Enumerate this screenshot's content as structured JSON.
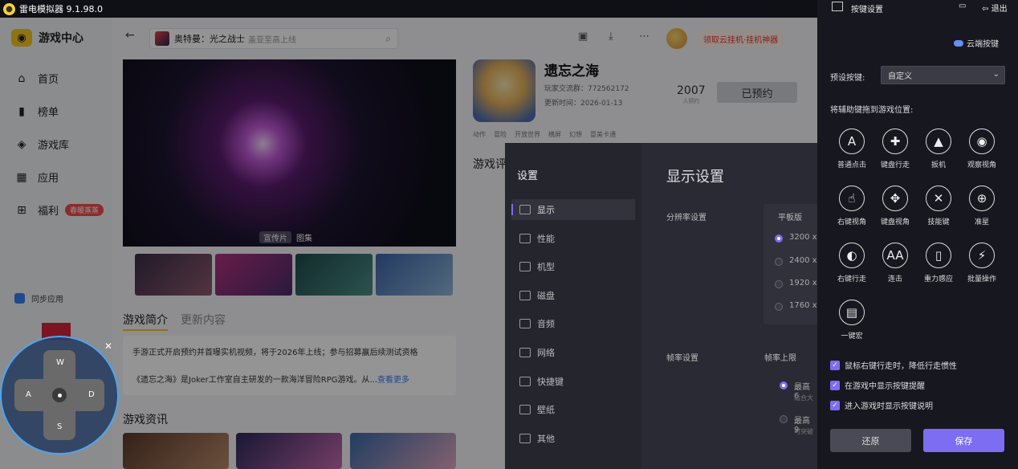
{
  "titlebar": {
    "title": "雷电模拟器 9.1.98.0"
  },
  "sidebar": {
    "brand": "游戏中心",
    "items": [
      {
        "label": "首页",
        "icon": "home-icon"
      },
      {
        "label": "榜单",
        "icon": "chart-icon"
      },
      {
        "label": "游戏库",
        "icon": "gamepad-icon"
      },
      {
        "label": "应用",
        "icon": "apps-icon"
      },
      {
        "label": "福利",
        "icon": "gift-icon",
        "badge": "春暖蒸蒸"
      }
    ],
    "sync": "同步应用"
  },
  "search": {
    "game": "奥特曼：光之战士",
    "placeholder": "盖亚至高上线"
  },
  "promo": "领取云挂机·挂机神器",
  "hero": {
    "tab_video": "宣传片",
    "tab_gallery": "图集"
  },
  "game": {
    "title": "遗忘之海",
    "group": "玩家交流群：772562172",
    "update": "更新时间：2026-01-13",
    "tags": [
      "动作",
      "冒险",
      "开放世界",
      "横屏",
      "幻想",
      "冒美卡通"
    ],
    "rating": "2007",
    "rating_sub": "人预约",
    "reserve_label": "已预约",
    "review_title": "游戏评"
  },
  "intro": {
    "tab_active": "游戏简介",
    "tab_other": "更新内容",
    "line1": "手游正式开启预约并首曝实机视频，将于2026年上线；参与招募赢后续测试资格",
    "line2": "《遗忘之海》是Joker工作室自主研发的一款海洋冒险RPG游戏。从...",
    "more": "查看更多"
  },
  "news_title": "游戏资讯",
  "settings": {
    "header": "设置",
    "items": [
      "显示",
      "性能",
      "机型",
      "磁盘",
      "音频",
      "网络",
      "快捷键",
      "壁纸",
      "其他"
    ],
    "active": 0,
    "title": "显示设置",
    "resolution_label": "分辨率设置",
    "tablet_label": "平板版",
    "resolutions": [
      "3200 x",
      "2400 x",
      "1920 x",
      "1760 x"
    ],
    "fps_label": "帧率设置",
    "fps_max_label": "帧率上限",
    "fps_opt1": "最高 6",
    "fps_opt1_sub": "适合大",
    "fps_opt2": "最高 9",
    "fps_opt2_sub": "可突破"
  },
  "keypanel": {
    "title": "按键设置",
    "exit": "退出",
    "cloud": "云端按键",
    "preset_label": "预设按键:",
    "preset_value": "自定义",
    "drag_hint": "将辅助键拖到游戏位置:",
    "keys": [
      {
        "label": "普通点击",
        "glyph": "A",
        "icon": "tap-a-icon"
      },
      {
        "label": "键盘行走",
        "glyph": "✚",
        "icon": "dpad-icon"
      },
      {
        "label": "扳机",
        "glyph": "▲",
        "icon": "bullet-icon"
      },
      {
        "label": "观察视角",
        "glyph": "◉",
        "icon": "eye-icon"
      },
      {
        "label": "右键视角",
        "glyph": "☝",
        "icon": "right-view-icon"
      },
      {
        "label": "键盘视角",
        "glyph": "✥",
        "icon": "keyboard-view-icon"
      },
      {
        "label": "技能键",
        "glyph": "✕",
        "icon": "skill-icon"
      },
      {
        "label": "准星",
        "glyph": "⊕",
        "icon": "crosshair-icon"
      },
      {
        "label": "右键行走",
        "glyph": "◐",
        "icon": "mouse-icon"
      },
      {
        "label": "连击",
        "glyph": "AA",
        "icon": "combo-icon"
      },
      {
        "label": "重力感应",
        "glyph": "▯",
        "icon": "gravity-icon"
      },
      {
        "label": "批量操作",
        "glyph": "⚡",
        "icon": "batch-icon"
      },
      {
        "label": "一键宏",
        "glyph": "▤",
        "icon": "macro-icon"
      }
    ],
    "checks": [
      "鼠标右键行走时，降低行走惯性",
      "在游戏中显示按键提醒",
      "进入游戏时显示按键说明"
    ],
    "restore": "还原",
    "save": "保存"
  },
  "dpad": {
    "up": "W",
    "left": "A",
    "right": "D",
    "down": "S"
  }
}
